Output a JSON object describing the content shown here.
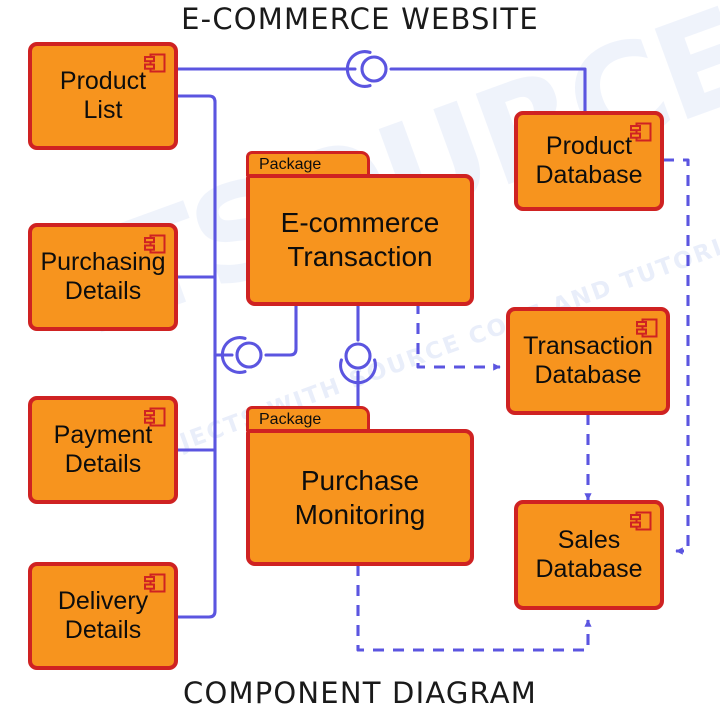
{
  "diagram": {
    "title_top": "E-COMMERCE WEBSITE",
    "title_bottom": "COMPONENT DIAGRAM",
    "watermark_main": "ITSOURCECODE",
    "watermark_sub": "PROJECTS WITH SOURCE CODE AND TUTORIALS",
    "colors": {
      "component_fill": "#f7941e",
      "component_border": "#cf2222",
      "connector": "#5b55e0",
      "text": "#0d0d0d",
      "background": "#ffffff"
    },
    "components": [
      {
        "id": "product-list",
        "label": "Product\nList",
        "icon": "component-icon"
      },
      {
        "id": "purchasing-details",
        "label": "Purchasing\nDetails",
        "icon": "component-icon"
      },
      {
        "id": "payment-details",
        "label": "Payment\nDetails",
        "icon": "component-icon"
      },
      {
        "id": "delivery-details",
        "label": "Delivery\nDetails",
        "icon": "component-icon"
      },
      {
        "id": "product-database",
        "label": "Product\nDatabase",
        "icon": "component-icon"
      },
      {
        "id": "transaction-database",
        "label": "Transaction\nDatabase",
        "icon": "component-icon"
      },
      {
        "id": "sales-database",
        "label": "Sales\nDatabase",
        "icon": "component-icon"
      }
    ],
    "packages": [
      {
        "id": "ecommerce-transaction",
        "stereotype": "Package",
        "label": "E-commerce\nTransaction"
      },
      {
        "id": "purchase-monitoring",
        "stereotype": "Package",
        "label": "Purchase\nMonitoring"
      }
    ],
    "connectors": [
      {
        "id": "assembly-product-list-to-product-database",
        "type": "ball-and-socket",
        "orientation": "horizontal"
      },
      {
        "id": "assembly-bus-to-ecommerce-transaction",
        "type": "ball-and-socket",
        "orientation": "horizontal"
      },
      {
        "id": "assembly-ecommerce-transaction-bottom",
        "type": "ball-and-socket",
        "orientation": "vertical"
      }
    ],
    "dependencies": [
      {
        "id": "dep-ecommerce-transaction-to-transaction-database",
        "style": "dashed",
        "arrow": "open"
      },
      {
        "id": "dep-product-database-to-sales-database",
        "style": "dashed",
        "arrow": "open"
      },
      {
        "id": "dep-transaction-database-to-sales-database",
        "style": "dashed",
        "arrow": "open"
      },
      {
        "id": "dep-purchase-monitoring-to-sales-database",
        "style": "dashed",
        "arrow": "open"
      }
    ]
  }
}
